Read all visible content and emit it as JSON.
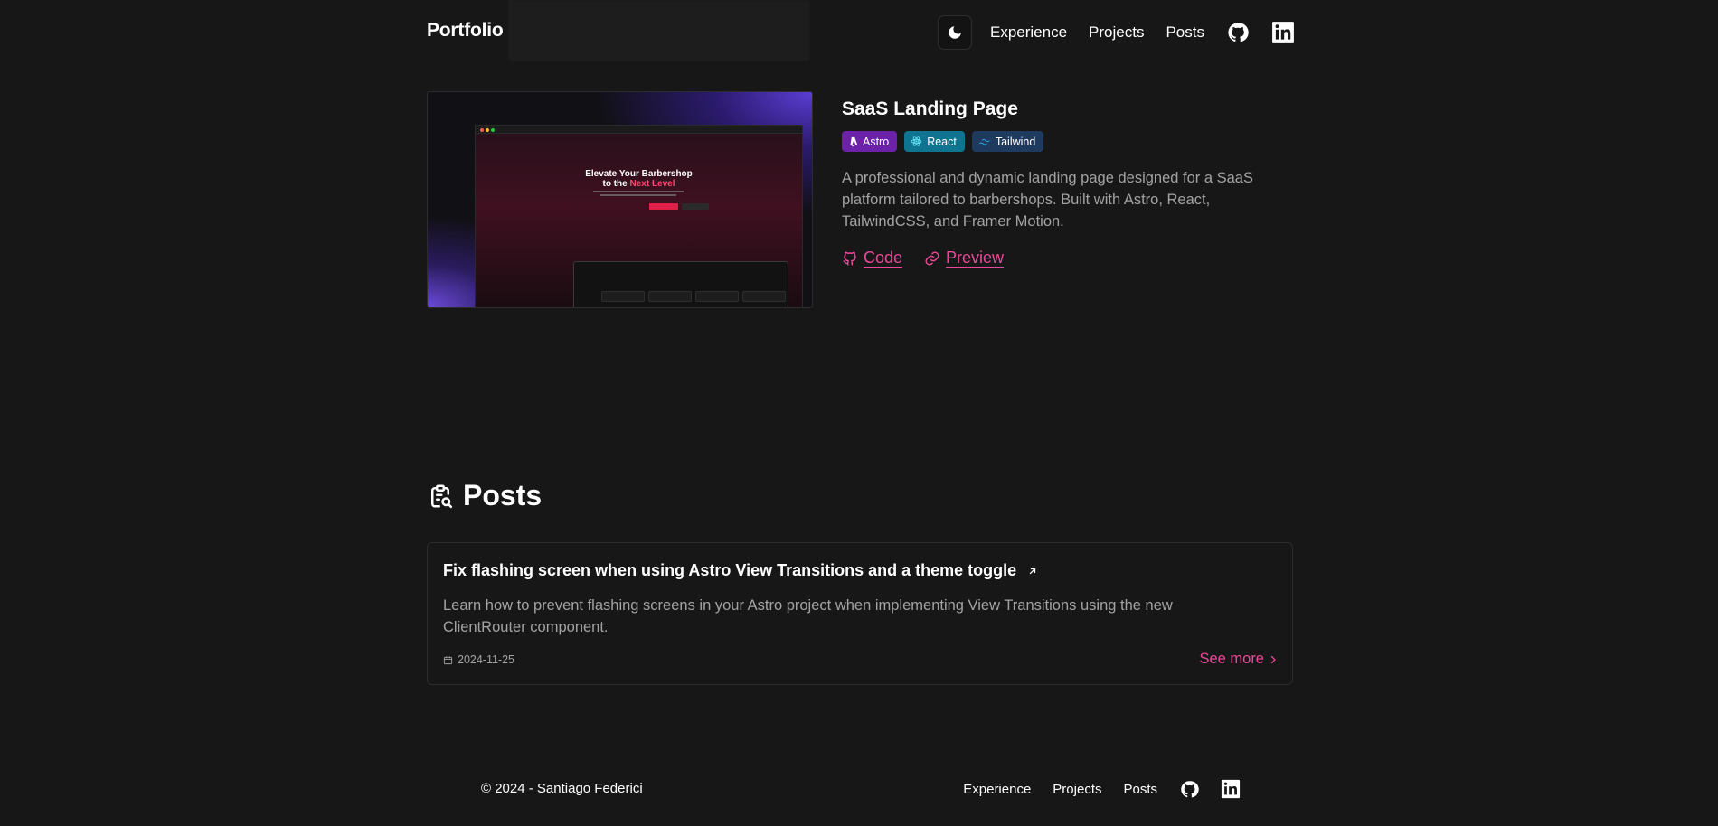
{
  "header": {
    "brand": "Portfolio",
    "nav": [
      "Experience",
      "Projects",
      "Posts"
    ]
  },
  "project": {
    "title": "SaaS Landing Page",
    "tags": [
      "Astro",
      "React",
      "Tailwind"
    ],
    "description": "A professional and dynamic landing page designed for a SaaS platform tailored to barbershops. Built with Astro, React, TailwindCSS, and Framer Motion.",
    "links": {
      "code": "Code",
      "preview": "Preview"
    },
    "screenshot": {
      "hero_line1": "Elevate Your Barbershop",
      "hero_line2_prefix": "to the ",
      "hero_line2_highlight": "Next Level"
    }
  },
  "posts": {
    "heading": "Posts",
    "items": [
      {
        "title": "Fix flashing screen when using Astro View Transitions and a theme toggle",
        "description": "Learn how to prevent flashing screens in your Astro project when implementing View Transitions using the new ClientRouter component.",
        "date": "2024-11-25",
        "more": "See more"
      }
    ]
  },
  "footer": {
    "copyright": "© 2024 - Santiago Federici",
    "nav": [
      "Experience",
      "Projects",
      "Posts"
    ]
  },
  "colors": {
    "accent": "#ec4899",
    "background": "#171717",
    "muted": "#a3a3a3"
  }
}
